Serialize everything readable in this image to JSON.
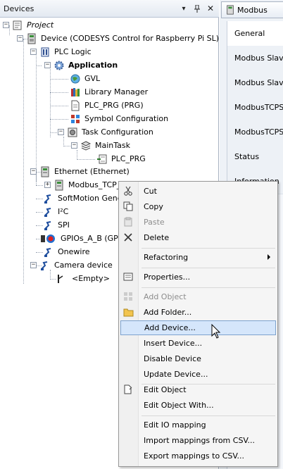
{
  "panel": {
    "title": "Devices",
    "pin_glyph": "↓",
    "tack_glyph": "(",
    "close_glyph": "✕"
  },
  "tree": {
    "project": "Project",
    "device": "Device (CODESYS Control for Raspberry Pi SL)",
    "plc_logic": "PLC Logic",
    "application": "Application",
    "gvl": "GVL",
    "library_manager": "Library Manager",
    "plc_prg": "PLC_PRG (PRG)",
    "symbol_configuration": "Symbol Configuration",
    "task_configuration": "Task Configuration",
    "main_task": "MainTask",
    "plc_prg_call": "PLC_PRG",
    "ethernet": "Ethernet (Ethernet)",
    "modbus_tcp": "Modbus_TCP_",
    "softmotion": "SoftMotion Genera",
    "i2c": "I²C",
    "spi": "SPI",
    "gpios": "GPIOs_A_B (GPI",
    "onewire": "Onewire",
    "camera": "Camera device",
    "empty": "<Empty>"
  },
  "editor": {
    "tab_label": "Modbus",
    "props": [
      "General",
      "Modbus Slave",
      "Modbus Slave",
      "ModbusTCPSla",
      "ModbusTCPSla",
      "Status",
      "Information"
    ]
  },
  "menu": {
    "cut": "Cut",
    "copy": "Copy",
    "paste": "Paste",
    "delete": "Delete",
    "refactoring": "Refactoring",
    "properties": "Properties...",
    "add_object": "Add Object",
    "add_folder": "Add Folder...",
    "add_device": "Add Device...",
    "insert_device": "Insert Device...",
    "disable_device": "Disable Device",
    "update_device": "Update Device...",
    "edit_object": "Edit Object",
    "edit_object_with": "Edit Object With...",
    "edit_io_mapping": "Edit IO mapping",
    "import_mappings": "Import mappings from CSV...",
    "export_mappings": "Export mappings to CSV..."
  },
  "colors": {
    "menu_highlight": "#d5e6fb",
    "menu_highlight_border": "#7da2ce",
    "disabled_text": "#8d8d8d"
  }
}
